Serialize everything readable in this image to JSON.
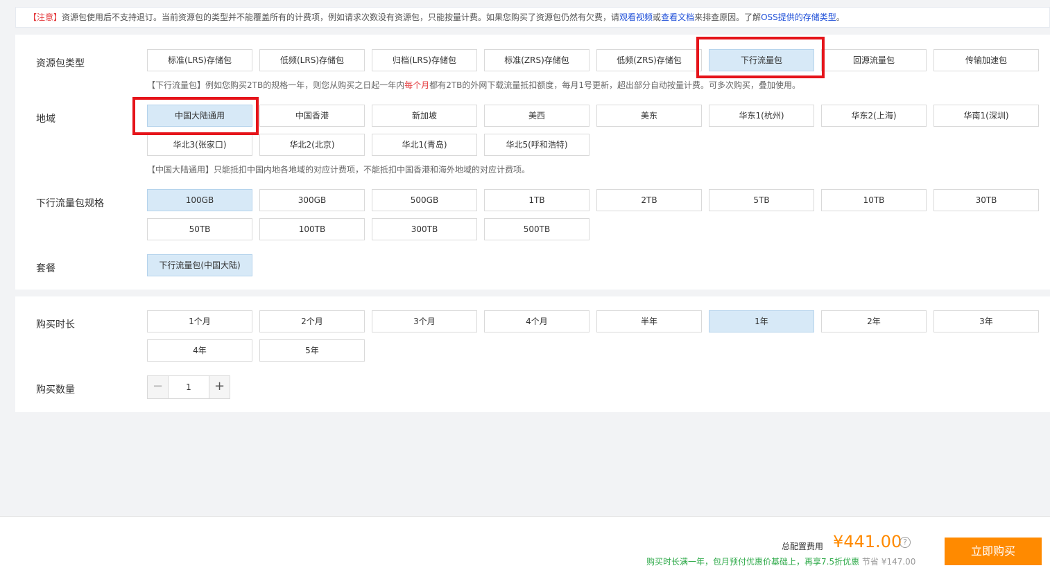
{
  "notice": {
    "warn": "【注意】",
    "text1": "资源包使用后不支持退订。当前资源包的类型并不能覆盖所有的计费项，例如请求次数没有资源包，只能按量计费。如果您购买了资源包仍然有欠费，请",
    "link1": "观看视频",
    "or": "或",
    "link2": "查看文档",
    "text2": "来排查原因。了解",
    "link3": "OSS提供的存储类型",
    "end": "。"
  },
  "package_type": {
    "label": "资源包类型",
    "options": [
      "标准(LRS)存储包",
      "低频(LRS)存储包",
      "归档(LRS)存储包",
      "标准(ZRS)存储包",
      "低频(ZRS)存储包",
      "下行流量包",
      "回源流量包",
      "传输加速包"
    ],
    "selected": "下行流量包",
    "hint_a": "【下行流量包】例如您购买2TB的规格一年，则您从购买之日起一年内",
    "hint_red": "每个月",
    "hint_b": "都有2TB的外网下载流量抵扣额度，每月1号更新，超出部分自动按量计费。可多次购买，叠加使用。"
  },
  "region": {
    "label": "地域",
    "options": [
      "中国大陆通用",
      "中国香港",
      "新加坡",
      "美西",
      "美东",
      "华东1(杭州)",
      "华东2(上海)",
      "华南1(深圳)",
      "华北3(张家口)",
      "华北2(北京)",
      "华北1(青岛)",
      "华北5(呼和浩特)"
    ],
    "selected": "中国大陆通用",
    "hint": "【中国大陆通用】只能抵扣中国内地各地域的对应计费项，不能抵扣中国香港和海外地域的对应计费项。"
  },
  "spec": {
    "label": "下行流量包规格",
    "options": [
      "100GB",
      "300GB",
      "500GB",
      "1TB",
      "2TB",
      "5TB",
      "10TB",
      "30TB",
      "50TB",
      "100TB",
      "300TB",
      "500TB"
    ],
    "selected": "100GB"
  },
  "plan": {
    "label": "套餐",
    "options": [
      "下行流量包(中国大陆)"
    ],
    "selected": "下行流量包(中国大陆)"
  },
  "duration": {
    "label": "购买时长",
    "options": [
      "1个月",
      "2个月",
      "3个月",
      "4个月",
      "半年",
      "1年",
      "2年",
      "3年",
      "4年",
      "5年"
    ],
    "selected": "1年"
  },
  "quantity": {
    "label": "购买数量",
    "minus": "−",
    "value": "1",
    "plus": "+"
  },
  "footer": {
    "total_label": "总配置费用",
    "price": "¥441.00",
    "help": "?",
    "discount": "购买时长满一年，包月预付优惠价基础上，再享7.5折优惠",
    "save": "节省 ¥147.00",
    "buy": "立即购买"
  },
  "colors": {
    "accent": "#ff8a00",
    "selected_bg": "#d7e9f7",
    "highlight_box": "#e5141a",
    "discount": "#2faa4a"
  }
}
